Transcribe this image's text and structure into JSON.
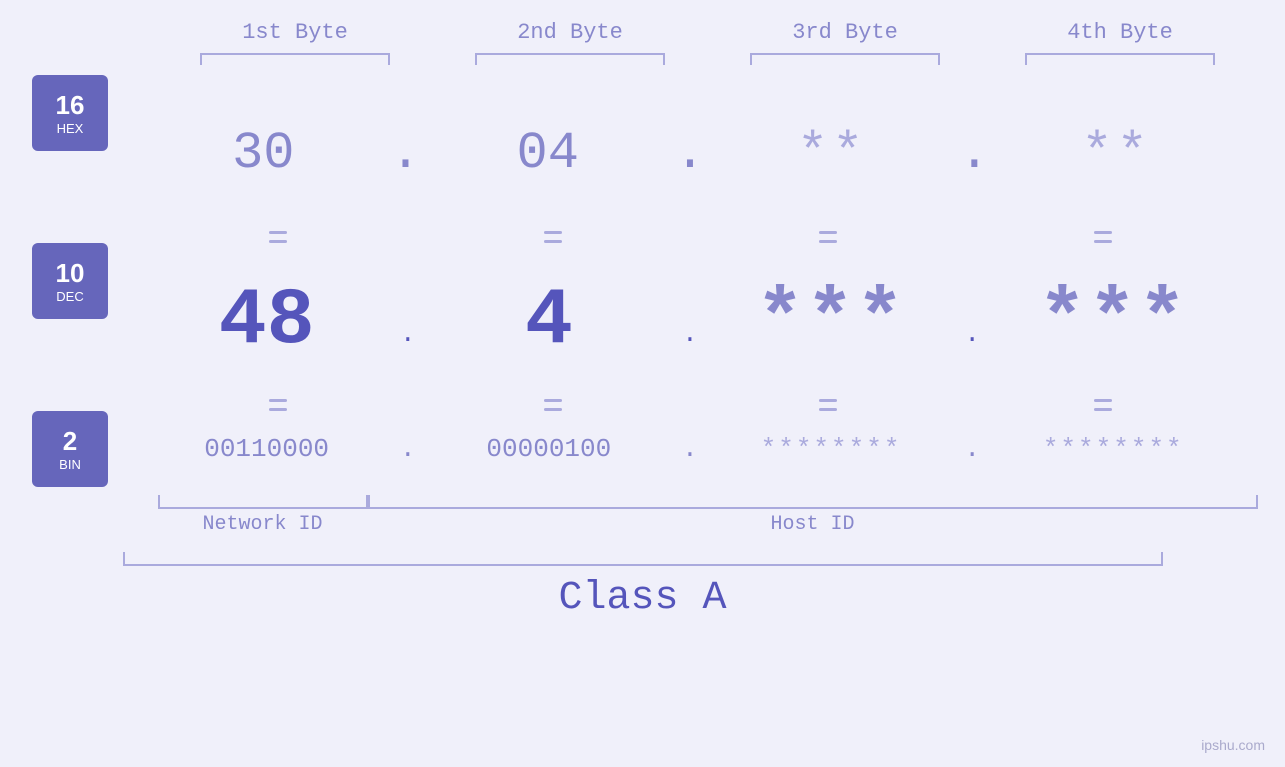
{
  "header": {
    "bytes": [
      "1st Byte",
      "2nd Byte",
      "3rd Byte",
      "4th Byte"
    ]
  },
  "bases": [
    {
      "num": "16",
      "label": "HEX"
    },
    {
      "num": "10",
      "label": "DEC"
    },
    {
      "num": "2",
      "label": "BIN"
    }
  ],
  "rows": {
    "hex": {
      "values": [
        "30",
        "04",
        "**",
        "**"
      ],
      "dots": [
        ".",
        ".",
        ".",
        ""
      ]
    },
    "dec": {
      "values": [
        "48",
        "4",
        "***",
        "***"
      ],
      "dots": [
        ".",
        ".",
        ".",
        ""
      ]
    },
    "bin": {
      "values": [
        "00110000",
        "00000100",
        "********",
        "********"
      ],
      "dots": [
        ".",
        ".",
        ".",
        ""
      ]
    }
  },
  "labels": {
    "network_id": "Network ID",
    "host_id": "Host ID",
    "class": "Class A"
  },
  "watermark": "ipshu.com"
}
